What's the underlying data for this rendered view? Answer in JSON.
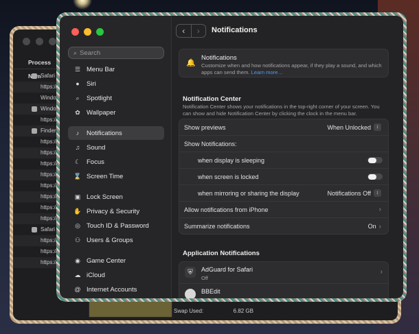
{
  "back_window": {
    "column_header": "Process Nam",
    "processes": [
      {
        "name": "Safari T",
        "icon": "compass-icon"
      },
      {
        "name": "https://"
      },
      {
        "name": "Window"
      },
      {
        "name": "Window",
        "icon": "window-icon"
      },
      {
        "name": "https://"
      },
      {
        "name": "Finder",
        "icon": "finder-icon"
      },
      {
        "name": "https://"
      },
      {
        "name": "https://"
      },
      {
        "name": "https://"
      },
      {
        "name": "https://"
      },
      {
        "name": "https://"
      },
      {
        "name": "https://"
      },
      {
        "name": "https://"
      },
      {
        "name": "https://"
      },
      {
        "name": "Safari T",
        "icon": "cube-icon"
      },
      {
        "name": "https://"
      },
      {
        "name": "https://"
      },
      {
        "name": "https://"
      }
    ],
    "swap_label": "Swap Used:",
    "swap_value": "6.82 GB"
  },
  "sidebar": {
    "search_placeholder": "Search",
    "items": [
      {
        "label": "Menu Bar",
        "icon": "menu-bar-icon"
      },
      {
        "label": "Siri",
        "icon": "siri-icon"
      },
      {
        "label": "Spotlight",
        "icon": "spotlight-icon"
      },
      {
        "label": "Wallpaper",
        "icon": "wallpaper-icon"
      },
      {
        "label": "Notifications",
        "icon": "bell-icon",
        "active": true
      },
      {
        "label": "Sound",
        "icon": "speaker-icon"
      },
      {
        "label": "Focus",
        "icon": "moon-icon"
      },
      {
        "label": "Screen Time",
        "icon": "hourglass-icon"
      },
      {
        "label": "Lock Screen",
        "icon": "lock-icon"
      },
      {
        "label": "Privacy & Security",
        "icon": "hand-icon"
      },
      {
        "label": "Touch ID & Password",
        "icon": "fingerprint-icon"
      },
      {
        "label": "Users & Groups",
        "icon": "users-icon"
      },
      {
        "label": "Game Center",
        "icon": "game-center-icon"
      },
      {
        "label": "iCloud",
        "icon": "cloud-icon"
      },
      {
        "label": "Internet Accounts",
        "icon": "at-icon"
      }
    ]
  },
  "main": {
    "title": "Notifications",
    "header_card": {
      "title": "Notifications",
      "description": "Customize when and how notifications appear, if they play a sound, and which apps can send them.",
      "link": "Learn more…"
    },
    "notification_center": {
      "title": "Notification Center",
      "description": "Notification Center shows your notifications in the top-right corner of your screen. You can show and hide Notification Center by clicking the clock in the menu bar."
    },
    "rows": {
      "show_previews": {
        "label": "Show previews",
        "value": "When Unlocked"
      },
      "show_notifications": {
        "label": "Show Notifications:"
      },
      "display_sleeping": {
        "label": "when display is sleeping",
        "enabled": false
      },
      "screen_locked": {
        "label": "when screen is locked",
        "enabled": false
      },
      "mirroring": {
        "label": "when mirroring or sharing the display",
        "value": "Notifications Off"
      },
      "allow_iphone": {
        "label": "Allow notifications from iPhone"
      },
      "summarize": {
        "label": "Summarize notifications",
        "value": "On"
      }
    },
    "app_notifications": {
      "title": "Application Notifications",
      "apps": [
        {
          "name": "AdGuard for Safari",
          "status": "Off"
        },
        {
          "name": "BBEdit",
          "status": ""
        }
      ]
    }
  },
  "colors": {
    "accent_link": "#4c9cf7",
    "close": "#ff5f57",
    "minimize": "#febc2e",
    "zoom": "#28c840"
  }
}
